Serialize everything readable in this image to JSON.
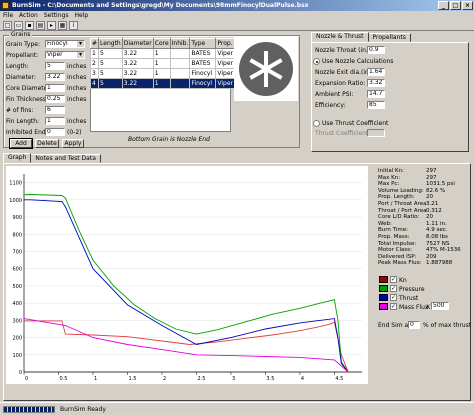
{
  "window": {
    "title": "BurnSim - C:\\Documents and Settings\\gregd\\My Documents\\98mmFinocylDualPulse.bsx"
  },
  "menu": [
    "File",
    "Action",
    "Settings",
    "Help"
  ],
  "toolbar": {
    "icons": [
      "new-icon",
      "open-icon",
      "save-icon",
      "print-icon",
      "run-icon",
      "chart-icon",
      "info-icon"
    ]
  },
  "grains": {
    "title": "Grains",
    "labels": {
      "grain_type": "Grain Type:",
      "propellant": "Propellant:",
      "length": "Length:",
      "diameter": "Diameter:",
      "core_diameter": "Core Diameter:",
      "fin_thickness": "Fin Thickness:",
      "num_fins": "# of fins:",
      "fin_length": "Fin Length:",
      "inhibited_ends": "Inhibited Ends:"
    },
    "values": {
      "grain_type": "Finocyl",
      "propellant": "Viper",
      "length": "5",
      "diameter": "3.22",
      "core_diameter": "1",
      "fin_thickness": "0.25",
      "num_fins": "6",
      "fin_length": "1",
      "inhibited_ends": "0"
    },
    "units": {
      "length": "inches",
      "diameter": "inches",
      "core_diameter": "inches",
      "fin_thickness": "inches",
      "fin_length": "inches",
      "inhibited_ends": "(0-2)"
    },
    "buttons": {
      "add": "Add",
      "delete": "Delete",
      "apply": "Apply"
    },
    "table": {
      "headers": [
        "#",
        "Length",
        "Diameter",
        "Core",
        "Inhib.",
        "Type",
        "Prop."
      ],
      "rows": [
        [
          "1",
          "5",
          "3.22",
          "1",
          "",
          "BATES",
          "Viper"
        ],
        [
          "2",
          "5",
          "3.22",
          "1",
          "",
          "BATES",
          "Viper"
        ],
        [
          "3",
          "5",
          "3.22",
          "1",
          "",
          "Finocyl",
          "Viper"
        ],
        [
          "4",
          "5",
          "3.22",
          "1",
          "",
          "Finocyl",
          "Viper"
        ]
      ],
      "selected_row": 3
    },
    "caption": "Bottom Grain is Nozzle End"
  },
  "nozzle": {
    "tabs": [
      "Nozzle & Thrust",
      "Propellants"
    ],
    "throat_label": "Nozzle Throat (in.):",
    "throat_value": "0.9",
    "use_calc_label": "Use Nozzle Calculations",
    "exit_label": "Nozzle Exit dia.(in.):",
    "exit_value": "1.64",
    "expansion_label": "Expansion Ratio:",
    "expansion_value": "3.32",
    "ambient_label": "Ambient PSI:",
    "ambient_value": "14.7",
    "efficiency_label": "Efficiency:",
    "efficiency_value": "85",
    "use_coeff_label": "Use Thrust Coefficient",
    "coeff_label": "Thrust Coefficient:",
    "coeff_value": ""
  },
  "graph": {
    "tabs": [
      "Graph",
      "Notes and Test Data"
    ],
    "stats": [
      [
        "Initial Kn:",
        "297"
      ],
      [
        "Max Kn:",
        "297"
      ],
      [
        "Max Pc:",
        "1031.5 psi"
      ],
      [
        "Volume Loading:",
        "82.6 %"
      ],
      [
        "Prop. Length:",
        "20"
      ],
      [
        "Port / Throat Area:",
        "3.21"
      ],
      [
        "Throat / Port Area:",
        "0.312"
      ],
      [
        "Core L/D Ratio:",
        "20"
      ],
      [
        "Web:",
        "1.11 in."
      ],
      [
        "Burn Time:",
        "4.9 sec."
      ],
      [
        "Prop. Mass:",
        "8.08 lbs"
      ],
      [
        "Total Impulse:",
        "7527 NS"
      ],
      [
        "Motor Class:",
        "47% M-1536"
      ],
      [
        "Delivered ISP:",
        "209"
      ],
      [
        "Peak Mass Flux:",
        "1.887988"
      ]
    ],
    "legend": [
      "Kn",
      "Pressure",
      "Thrust",
      "Mass Flux"
    ],
    "legend_colors": [
      "#a00000",
      "#00a000",
      "#0000c0",
      "#e000e0"
    ],
    "mass_flux_mult_label": "X",
    "mass_flux_mult": "500",
    "end_sim_label": "End Sim at",
    "end_sim_value": "0",
    "end_sim_unit": "% of max thrust"
  },
  "chart_data": {
    "type": "line",
    "xticks": [
      "0",
      "0.5",
      "1",
      "1.5",
      "2",
      "2.5",
      "3",
      "3.5",
      "4",
      "4.5"
    ],
    "yticks": [
      "0",
      "100",
      "200",
      "300",
      "400",
      "500",
      "600",
      "700",
      "800",
      "900",
      "1000",
      "1100"
    ],
    "xlim": [
      0,
      4.9
    ],
    "ylim": [
      0,
      1150
    ],
    "series": [
      {
        "name": "Kn",
        "color": "#e04040",
        "x": [
          0,
          0.1,
          0.55,
          0.6,
          1.0,
          1.5,
          2.0,
          2.4,
          2.8,
          3.2,
          3.6,
          4.0,
          4.3,
          4.45,
          4.5,
          4.6,
          4.7
        ],
        "y": [
          297,
          297,
          297,
          220,
          215,
          205,
          180,
          160,
          175,
          195,
          215,
          240,
          265,
          280,
          290,
          100,
          0
        ]
      },
      {
        "name": "Pressure",
        "color": "#00a000",
        "x": [
          0,
          0.1,
          0.55,
          0.6,
          0.8,
          1.0,
          1.3,
          1.6,
          1.9,
          2.2,
          2.5,
          2.8,
          3.2,
          3.6,
          4.0,
          4.3,
          4.5,
          4.55,
          4.6,
          4.7
        ],
        "y": [
          1030,
          1031,
          1025,
          1010,
          820,
          650,
          500,
          390,
          310,
          250,
          220,
          245,
          290,
          335,
          370,
          400,
          420,
          300,
          60,
          0
        ]
      },
      {
        "name": "Thrust",
        "color": "#0000c0",
        "x": [
          0,
          0.1,
          0.55,
          0.6,
          1.0,
          1.5,
          2.0,
          2.5,
          3.0,
          3.5,
          4.0,
          4.5,
          4.55,
          4.6,
          4.7
        ],
        "y": [
          1000,
          1000,
          990,
          960,
          600,
          390,
          270,
          160,
          200,
          250,
          285,
          310,
          200,
          50,
          0
        ]
      },
      {
        "name": "Mass Flux",
        "color": "#e000e0",
        "x": [
          0,
          0.6,
          1.0,
          1.5,
          2.0,
          2.5,
          3.0,
          3.5,
          4.0,
          4.5,
          4.7
        ],
        "y": [
          310,
          270,
          200,
          160,
          130,
          100,
          95,
          90,
          85,
          70,
          0
        ]
      }
    ]
  },
  "status": {
    "text": "BurnSim Ready"
  }
}
